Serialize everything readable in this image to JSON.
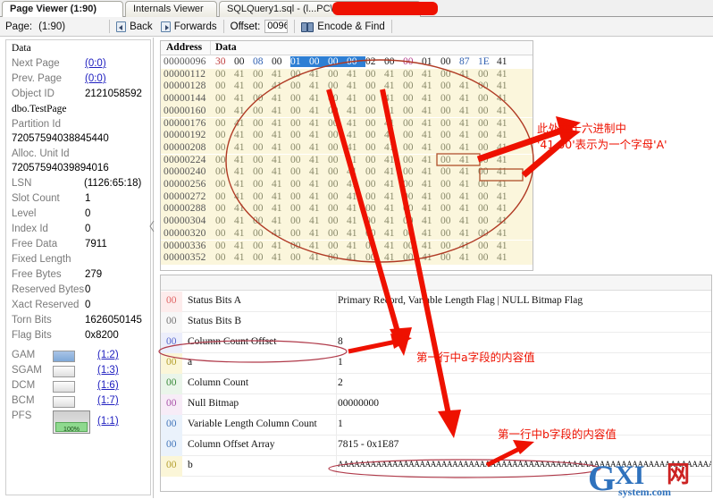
{
  "window": {
    "tabs": [
      {
        "label": "Page Viewer (1:90)",
        "active": true
      },
      {
        "label": "Internals Viewer",
        "active": false
      },
      {
        "label": "SQLQuery1.sql - (l...PC\\",
        "active": false
      }
    ]
  },
  "toolbar": {
    "page_label": "Page:",
    "page_value": "(1:90)",
    "back_label": "Back",
    "forwards_label": "Forwards",
    "offset_label": "Offset:",
    "offset_value": "0096",
    "encode_find_label": "Encode & Find"
  },
  "sidebar": {
    "fields": [
      {
        "label": "Page Type",
        "value": "Data",
        "kind": "below-mono"
      },
      {
        "label": "Next Page",
        "value": "(0:0)",
        "kind": "link"
      },
      {
        "label": "Prev. Page",
        "value": "(0:0)",
        "kind": "link"
      },
      {
        "label": "Object ID",
        "value": "2121058592",
        "kind": "value"
      },
      {
        "label": "",
        "value": "dbo.TestPage",
        "kind": "below-mono"
      },
      {
        "label": "Partition Id",
        "value": "72057594038845440",
        "kind": "below"
      },
      {
        "label": "Alloc. Unit Id",
        "value": "72057594039894016",
        "kind": "below"
      },
      {
        "label": "LSN",
        "value": "(1126:65:18)",
        "kind": "value-right"
      },
      {
        "label": "Slot Count",
        "value": "1",
        "kind": "value"
      },
      {
        "label": "Level",
        "value": "0",
        "kind": "value"
      },
      {
        "label": "Index Id",
        "value": "0",
        "kind": "value"
      },
      {
        "label": "Free Data",
        "value": "7911",
        "kind": "value"
      },
      {
        "label": "Fixed Length",
        "value": "",
        "kind": "value"
      },
      {
        "label": "Free Bytes",
        "value": "279",
        "kind": "value"
      },
      {
        "label": "Reserved Bytes",
        "value": "0",
        "kind": "value"
      },
      {
        "label": "Xact Reserved",
        "value": "0",
        "kind": "value"
      },
      {
        "label": "Torn Bits",
        "value": "1626050145",
        "kind": "value"
      },
      {
        "label": "Flag Bits",
        "value": "0x8200",
        "kind": "value"
      }
    ],
    "maps": [
      {
        "label": "GAM",
        "link": "(1:2)",
        "swatch": "blue"
      },
      {
        "label": "SGAM",
        "link": "(1:3)",
        "swatch": "empty"
      },
      {
        "label": "DCM",
        "link": "(1:6)",
        "swatch": "empty"
      },
      {
        "label": "BCM",
        "link": "(1:7)",
        "swatch": "empty"
      },
      {
        "label": "PFS",
        "link": "(1:1)",
        "swatch": "pfs",
        "pfs_text": "100%"
      }
    ]
  },
  "hex": {
    "col_address": "Address",
    "col_data": "Data",
    "rows": [
      {
        "address": "00000096",
        "cells": [
          "30",
          "00",
          "08",
          "00",
          "01",
          "00",
          "00",
          "00",
          "02",
          "00",
          "00",
          "01",
          "00",
          "87",
          "1E",
          "41"
        ],
        "colors": [
          "red",
          "dark",
          "blue",
          "dark",
          "hl",
          "hl",
          "hl",
          "hl",
          "dark",
          "dark",
          "pink",
          "dark",
          "dark",
          "blue",
          "blue",
          "dark"
        ],
        "first": true
      },
      {
        "address": "00000112",
        "cells": [
          "00",
          "41",
          "00",
          "41",
          "00",
          "41",
          "00",
          "41",
          "00",
          "41",
          "00",
          "41",
          "00",
          "41",
          "00",
          "41"
        ]
      },
      {
        "address": "00000128",
        "cells": [
          "00",
          "41",
          "00",
          "41",
          "00",
          "41",
          "00",
          "41",
          "00",
          "41",
          "00",
          "41",
          "00",
          "41",
          "00",
          "41"
        ]
      },
      {
        "address": "00000144",
        "cells": [
          "00",
          "41",
          "00",
          "41",
          "00",
          "41",
          "00",
          "41",
          "00",
          "41",
          "00",
          "41",
          "00",
          "41",
          "00",
          "41"
        ]
      },
      {
        "address": "00000160",
        "cells": [
          "00",
          "41",
          "00",
          "41",
          "00",
          "41",
          "00",
          "41",
          "00",
          "41",
          "00",
          "41",
          "00",
          "41",
          "00",
          "41"
        ]
      },
      {
        "address": "00000176",
        "cells": [
          "00",
          "41",
          "00",
          "41",
          "00",
          "41",
          "00",
          "41",
          "00",
          "41",
          "00",
          "41",
          "00",
          "41",
          "00",
          "41"
        ]
      },
      {
        "address": "00000192",
        "cells": [
          "00",
          "41",
          "00",
          "41",
          "00",
          "41",
          "00",
          "41",
          "00",
          "41",
          "00",
          "41",
          "00",
          "41",
          "00",
          "41"
        ]
      },
      {
        "address": "00000208",
        "cells": [
          "00",
          "41",
          "00",
          "41",
          "00",
          "41",
          "00",
          "41",
          "00",
          "41",
          "00",
          "41",
          "00",
          "41",
          "00",
          "41"
        ]
      },
      {
        "address": "00000224",
        "cells": [
          "00",
          "41",
          "00",
          "41",
          "00",
          "41",
          "00",
          "41",
          "00",
          "41",
          "00",
          "41",
          "00",
          "41",
          "00",
          "41"
        ]
      },
      {
        "address": "00000240",
        "cells": [
          "00",
          "41",
          "00",
          "41",
          "00",
          "41",
          "00",
          "41",
          "00",
          "41",
          "00",
          "41",
          "00",
          "41",
          "00",
          "41"
        ]
      },
      {
        "address": "00000256",
        "cells": [
          "00",
          "41",
          "00",
          "41",
          "00",
          "41",
          "00",
          "41",
          "00",
          "41",
          "00",
          "41",
          "00",
          "41",
          "00",
          "41"
        ]
      },
      {
        "address": "00000272",
        "cells": [
          "00",
          "41",
          "00",
          "41",
          "00",
          "41",
          "00",
          "41",
          "00",
          "41",
          "00",
          "41",
          "00",
          "41",
          "00",
          "41"
        ]
      },
      {
        "address": "00000288",
        "cells": [
          "00",
          "41",
          "00",
          "41",
          "00",
          "41",
          "00",
          "41",
          "00",
          "41",
          "00",
          "41",
          "00",
          "41",
          "00",
          "41"
        ]
      },
      {
        "address": "00000304",
        "cells": [
          "00",
          "41",
          "00",
          "41",
          "00",
          "41",
          "00",
          "41",
          "00",
          "41",
          "00",
          "41",
          "00",
          "41",
          "00",
          "41"
        ]
      },
      {
        "address": "00000320",
        "cells": [
          "00",
          "41",
          "00",
          "41",
          "00",
          "41",
          "00",
          "41",
          "00",
          "41",
          "00",
          "41",
          "00",
          "41",
          "00",
          "41"
        ]
      },
      {
        "address": "00000336",
        "cells": [
          "00",
          "41",
          "00",
          "41",
          "00",
          "41",
          "00",
          "41",
          "00",
          "41",
          "00",
          "41",
          "00",
          "41",
          "00",
          "41"
        ]
      },
      {
        "address": "00000352",
        "cells": [
          "00",
          "41",
          "00",
          "41",
          "00",
          "41",
          "00",
          "41",
          "00",
          "41",
          "00",
          "41",
          "00",
          "41",
          "00",
          "41"
        ]
      }
    ]
  },
  "detail": {
    "rows": [
      {
        "mark": "00",
        "name": "Status Bits A",
        "value": "Primary Record, Variable Length Flag | NULL Bitmap Flag",
        "stripe": "#fdecec",
        "markcolor": "#e06666"
      },
      {
        "mark": "00",
        "name": "Status Bits B",
        "value": "",
        "stripe": "#f7f7f7",
        "markcolor": "#777777"
      },
      {
        "mark": "00",
        "name": "Column Count Offset",
        "value": "8",
        "stripe": "#eceefb",
        "markcolor": "#5566cc"
      },
      {
        "mark": "00",
        "name": "a",
        "value": "1",
        "stripe": "#fbf6d8",
        "markcolor": "#b5a030"
      },
      {
        "mark": "00",
        "name": "Column Count",
        "value": "2",
        "stripe": "#eaf5ea",
        "markcolor": "#3b8a3b"
      },
      {
        "mark": "00",
        "name": "Null Bitmap",
        "value": "00000000",
        "stripe": "#f7ecf7",
        "markcolor": "#aa55aa"
      },
      {
        "mark": "00",
        "name": "Variable Length Column Count",
        "value": "1",
        "stripe": "#eaf2fb",
        "markcolor": "#4477bb"
      },
      {
        "mark": "00",
        "name": "Column Offset Array",
        "value": "7815 - 0x1E87",
        "stripe": "#eaf2fb",
        "markcolor": "#4477bb"
      },
      {
        "mark": "00",
        "name": "b",
        "value": "AAAAAAAAAAAAAAAAAAAAAAAAAAAAAAAAAAAAAAAAAAAAAAAAAAAAAAAAAAAAAAAAAAAAAAAAAAAAAAAAAAAAAAA",
        "stripe": "#fbf6d8",
        "markcolor": "#b5a030"
      }
    ]
  },
  "annotations": {
    "hex_note_line1": "此处在十六进制中",
    "hex_note_line2": "'41 00'表示为一个字母'A'",
    "field_a_note": "第一行中a字段的内容值",
    "field_b_note": "第一行中b字段的内容值",
    "color": "#ee1100"
  },
  "watermark": {
    "g": "G",
    "xi": "XI",
    "cn": "网",
    "sub": "system.com"
  }
}
